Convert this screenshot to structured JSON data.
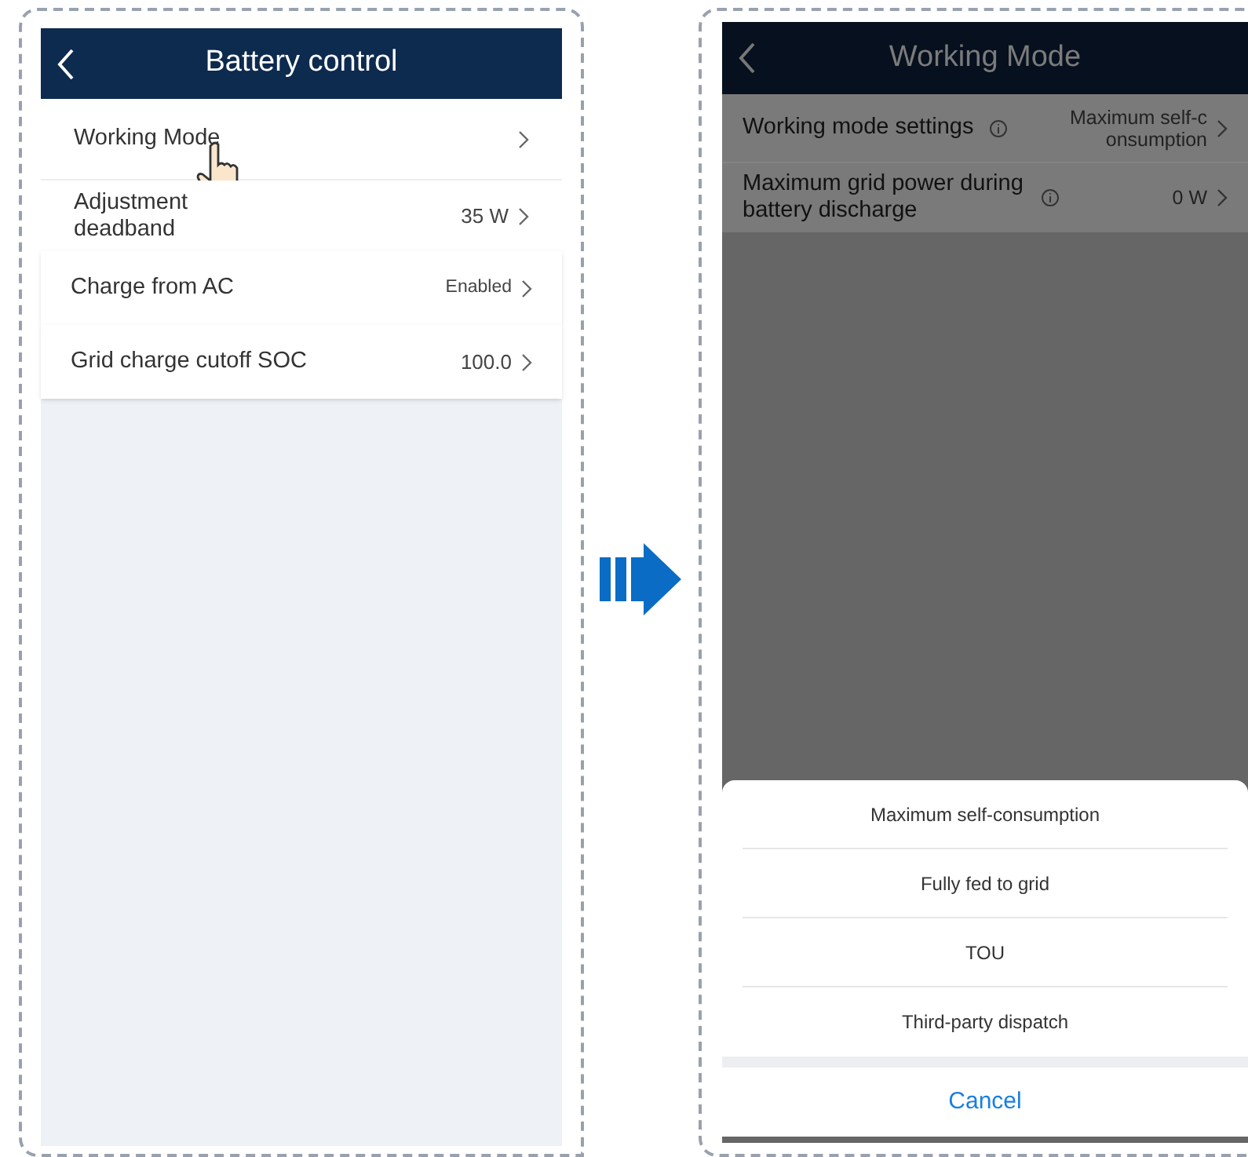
{
  "before_screen": {
    "title": "Battery control",
    "rows": [
      {
        "label": "Working Mode",
        "tapped": true
      },
      {
        "label": "Adjustment deadband",
        "value": "35 W",
        "tapped": false
      },
      {
        "label": "Charge from AC",
        "value": "Enabled",
        "tapped": false
      },
      {
        "label": "Grid charge cutoff SOC",
        "value": "100.0",
        "tapped": false
      }
    ]
  },
  "after_screen": {
    "title": "Working Mode",
    "rows": [
      {
        "label": "Working mode settings",
        "info": true,
        "value": "Maximum self-consumption"
      },
      {
        "label": "Maximum grid power during battery discharge",
        "info": true,
        "value": "0 W"
      }
    ],
    "option_sheet": {
      "options": [
        "Maximum self-consumption",
        "Fully fed to grid",
        "TOU",
        "Third-party dispatch"
      ],
      "cancel": "Cancel"
    }
  }
}
